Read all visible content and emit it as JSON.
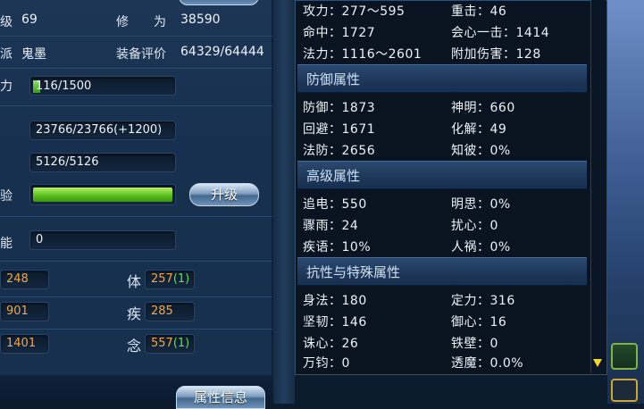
{
  "left": {
    "level_label": "级",
    "level_value": "69",
    "cultivation_label": "修　　为",
    "cultivation_value": "38590",
    "faction_label": "派",
    "faction_value": "鬼墨",
    "rating_label": "装备评价",
    "rating_value": "64329/64444",
    "power_label": "力",
    "power_value": "116/1500",
    "hp_value": "23766/23766(+1200)",
    "mp_value": "5126/5126",
    "exp_label": "验",
    "exp_fill": 1.0,
    "upgrade_button": "升级",
    "skill_label": "能",
    "skill_value": "0",
    "stats": [
      {
        "left_value": "248",
        "right_label": "体",
        "right_value": "257",
        "right_bonus": "(1)"
      },
      {
        "left_value": "901",
        "right_label": "疾",
        "right_value": "285",
        "right_bonus": ""
      },
      {
        "left_value": "1401",
        "right_label": "念",
        "right_value": "557",
        "right_bonus": "(1)"
      }
    ],
    "attr_info_button": "属性信息"
  },
  "right": {
    "attack": [
      {
        "a": "攻力：277～595",
        "b": "重击：46"
      },
      {
        "a": "命中：1727",
        "b": "会心一击：1414"
      },
      {
        "a": "法力：1116～2601",
        "b": "附加伤害：128"
      }
    ],
    "defense_header": "防御属性",
    "defense": [
      {
        "a": "防御：1873",
        "b": "神明：660"
      },
      {
        "a": "回避：1671",
        "b": "化解：49"
      },
      {
        "a": "法防：2656",
        "b": "知彼：0%"
      }
    ],
    "advanced_header": "高级属性",
    "advanced": [
      {
        "a": "追电：550",
        "b": "明思：0%"
      },
      {
        "a": "骤雨：24",
        "b": "扰心：0"
      },
      {
        "a": "疾语：10%",
        "b": "人祸：0%"
      }
    ],
    "resist_header": "抗性与特殊属性",
    "resist": [
      {
        "a": "身法：180",
        "b": "定力：316"
      },
      {
        "a": "坚韧：146",
        "b": "御心：16"
      },
      {
        "a": "诛心：26",
        "b": "铁壁：0"
      },
      {
        "a": "万钧：0",
        "b": "透魔：0.0%"
      }
    ]
  }
}
